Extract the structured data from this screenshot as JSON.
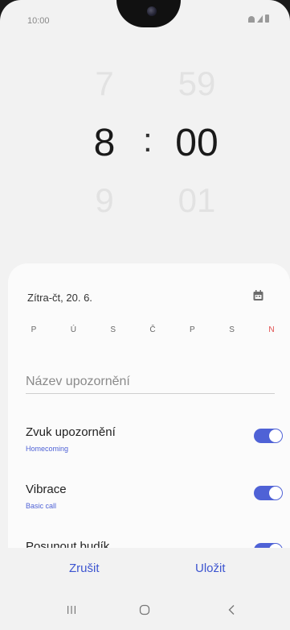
{
  "status_bar": {
    "time": "10:00"
  },
  "time_picker": {
    "hours": {
      "previous": "7",
      "current": "8",
      "next": "9"
    },
    "separator": ":",
    "minutes": {
      "previous": "59",
      "current": "00",
      "next": "01"
    }
  },
  "alarm": {
    "date_label": "Zítra-čt, 20. 6.",
    "weekdays": [
      "P",
      "Ú",
      "S",
      "Č",
      "P",
      "S",
      "N"
    ],
    "name_placeholder": "Název upozornění",
    "settings": [
      {
        "title": "Zvuk upozornění",
        "subtitle": "Homecoming",
        "enabled": true
      },
      {
        "title": "Vibrace",
        "subtitle": "Basic call",
        "enabled": true
      },
      {
        "title": "Posunout budík",
        "subtitle": "",
        "enabled": true
      }
    ]
  },
  "actions": {
    "cancel_label": "Zrušit",
    "save_label": "Uložit"
  },
  "colors": {
    "accent": "#4f62d6",
    "sunday": "#e04b4b"
  },
  "icons": [
    "calendar-icon",
    "recents-icon",
    "home-icon",
    "back-icon"
  ]
}
